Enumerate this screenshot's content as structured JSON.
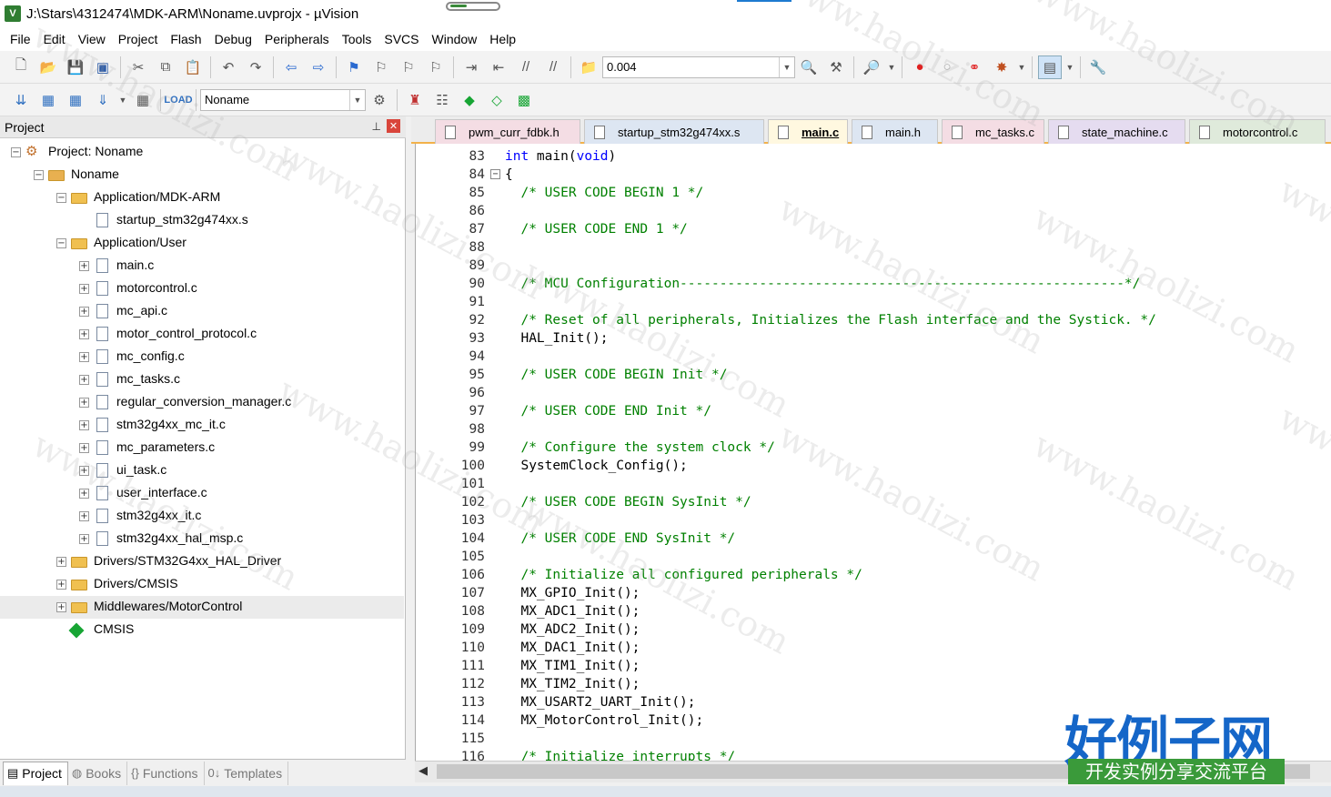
{
  "window": {
    "title": "J:\\Stars\\4312474\\MDK-ARM\\Noname.uvprojx - µVision",
    "app_icon_text": "V"
  },
  "menu": [
    "File",
    "Edit",
    "View",
    "Project",
    "Flash",
    "Debug",
    "Peripherals",
    "Tools",
    "SVCS",
    "Window",
    "Help"
  ],
  "toolbar": {
    "find_value": "0.004",
    "target_value": "Noname"
  },
  "project_panel": {
    "title": "Project",
    "tree": [
      {
        "label": "Project: Noname",
        "level": 0,
        "icon": "project-icon",
        "exp": "-"
      },
      {
        "label": "Noname",
        "level": 1,
        "icon": "target-icon",
        "exp": "-"
      },
      {
        "label": "Application/MDK-ARM",
        "level": 2,
        "icon": "folder-icon",
        "exp": "-"
      },
      {
        "label": "startup_stm32g474xx.s",
        "level": 3,
        "icon": "file-icon",
        "exp": ""
      },
      {
        "label": "Application/User",
        "level": 2,
        "icon": "folder-icon",
        "exp": "-"
      },
      {
        "label": "main.c",
        "level": 3,
        "icon": "file-icon",
        "exp": "+"
      },
      {
        "label": "motorcontrol.c",
        "level": 3,
        "icon": "file-icon",
        "exp": "+"
      },
      {
        "label": "mc_api.c",
        "level": 3,
        "icon": "file-icon",
        "exp": "+"
      },
      {
        "label": "motor_control_protocol.c",
        "level": 3,
        "icon": "file-icon",
        "exp": "+"
      },
      {
        "label": "mc_config.c",
        "level": 3,
        "icon": "file-icon",
        "exp": "+"
      },
      {
        "label": "mc_tasks.c",
        "level": 3,
        "icon": "file-icon",
        "exp": "+"
      },
      {
        "label": "regular_conversion_manager.c",
        "level": 3,
        "icon": "file-icon",
        "exp": "+"
      },
      {
        "label": "stm32g4xx_mc_it.c",
        "level": 3,
        "icon": "file-icon",
        "exp": "+"
      },
      {
        "label": "mc_parameters.c",
        "level": 3,
        "icon": "file-icon",
        "exp": "+"
      },
      {
        "label": "ui_task.c",
        "level": 3,
        "icon": "file-icon",
        "exp": "+"
      },
      {
        "label": "user_interface.c",
        "level": 3,
        "icon": "file-icon",
        "exp": "+"
      },
      {
        "label": "stm32g4xx_it.c",
        "level": 3,
        "icon": "file-icon",
        "exp": "+"
      },
      {
        "label": "stm32g4xx_hal_msp.c",
        "level": 3,
        "icon": "file-icon",
        "exp": "+"
      },
      {
        "label": "Drivers/STM32G4xx_HAL_Driver",
        "level": 2,
        "icon": "folder-icon",
        "exp": "+"
      },
      {
        "label": "Drivers/CMSIS",
        "level": 2,
        "icon": "folder-icon",
        "exp": "+"
      },
      {
        "label": "Middlewares/MotorControl",
        "level": 2,
        "icon": "folder-icon",
        "exp": "+",
        "selected": true
      },
      {
        "label": "CMSIS",
        "level": 2,
        "icon": "cmsis-icon",
        "exp": ""
      }
    ],
    "bottom_tabs": [
      {
        "label": "Project",
        "icon": "▤",
        "active": true
      },
      {
        "label": "Books",
        "icon": "◍",
        "active": false
      },
      {
        "label": "Functions",
        "icon": "{}",
        "active": false
      },
      {
        "label": "Templates",
        "icon": "0↓",
        "active": false
      }
    ]
  },
  "editor": {
    "tabs": [
      {
        "label": "pwm_curr_fdbk.h",
        "color": "#f4dde4",
        "active": false
      },
      {
        "label": "startup_stm32g474xx.s",
        "color": "#dde6f2",
        "active": false
      },
      {
        "label": "main.c",
        "color": "#fff8e0",
        "active": true
      },
      {
        "label": "main.h",
        "color": "#dde6f2",
        "active": false
      },
      {
        "label": "mc_tasks.c",
        "color": "#f4dde4",
        "active": false
      },
      {
        "label": "state_machine.c",
        "color": "#e5dcf0",
        "active": false
      },
      {
        "label": "motorcontrol.c",
        "color": "#dfeadb",
        "active": false
      }
    ],
    "lines": [
      {
        "n": "83",
        "code": "int main(void)",
        "type": "sig"
      },
      {
        "n": "84",
        "code": "{",
        "type": "plain",
        "fold": "-"
      },
      {
        "n": "85",
        "code": "  /* USER CODE BEGIN 1 */",
        "type": "comment"
      },
      {
        "n": "86",
        "code": "",
        "type": "plain"
      },
      {
        "n": "87",
        "code": "  /* USER CODE END 1 */",
        "type": "comment"
      },
      {
        "n": "88",
        "code": "",
        "type": "plain"
      },
      {
        "n": "89",
        "code": "",
        "type": "plain"
      },
      {
        "n": "90",
        "code": "  /* MCU Configuration--------------------------------------------------------*/",
        "type": "comment"
      },
      {
        "n": "91",
        "code": "",
        "type": "plain"
      },
      {
        "n": "92",
        "code": "  /* Reset of all peripherals, Initializes the Flash interface and the Systick. */",
        "type": "comment"
      },
      {
        "n": "93",
        "code": "  HAL_Init();",
        "type": "plain"
      },
      {
        "n": "94",
        "code": "",
        "type": "plain"
      },
      {
        "n": "95",
        "code": "  /* USER CODE BEGIN Init */",
        "type": "comment"
      },
      {
        "n": "96",
        "code": "",
        "type": "plain"
      },
      {
        "n": "97",
        "code": "  /* USER CODE END Init */",
        "type": "comment"
      },
      {
        "n": "98",
        "code": "",
        "type": "plain"
      },
      {
        "n": "99",
        "code": "  /* Configure the system clock */",
        "type": "comment"
      },
      {
        "n": "100",
        "code": "  SystemClock_Config();",
        "type": "plain"
      },
      {
        "n": "101",
        "code": "",
        "type": "plain"
      },
      {
        "n": "102",
        "code": "  /* USER CODE BEGIN SysInit */",
        "type": "comment"
      },
      {
        "n": "103",
        "code": "",
        "type": "plain"
      },
      {
        "n": "104",
        "code": "  /* USER CODE END SysInit */",
        "type": "comment"
      },
      {
        "n": "105",
        "code": "",
        "type": "plain"
      },
      {
        "n": "106",
        "code": "  /* Initialize all configured peripherals */",
        "type": "comment"
      },
      {
        "n": "107",
        "code": "  MX_GPIO_Init();",
        "type": "plain"
      },
      {
        "n": "108",
        "code": "  MX_ADC1_Init();",
        "type": "plain"
      },
      {
        "n": "109",
        "code": "  MX_ADC2_Init();",
        "type": "plain"
      },
      {
        "n": "110",
        "code": "  MX_DAC1_Init();",
        "type": "plain"
      },
      {
        "n": "111",
        "code": "  MX_TIM1_Init();",
        "type": "plain"
      },
      {
        "n": "112",
        "code": "  MX_TIM2_Init();",
        "type": "plain"
      },
      {
        "n": "113",
        "code": "  MX_USART2_UART_Init();",
        "type": "plain"
      },
      {
        "n": "114",
        "code": "  MX_MotorControl_Init();",
        "type": "plain"
      },
      {
        "n": "115",
        "code": "",
        "type": "plain"
      },
      {
        "n": "116",
        "code": "  /* Initialize interrupts */",
        "type": "comment"
      }
    ]
  },
  "watermark": {
    "text": "www.haolizi.com",
    "logo_main": "好例子网",
    "logo_sub": "开发实例分享交流平台"
  }
}
